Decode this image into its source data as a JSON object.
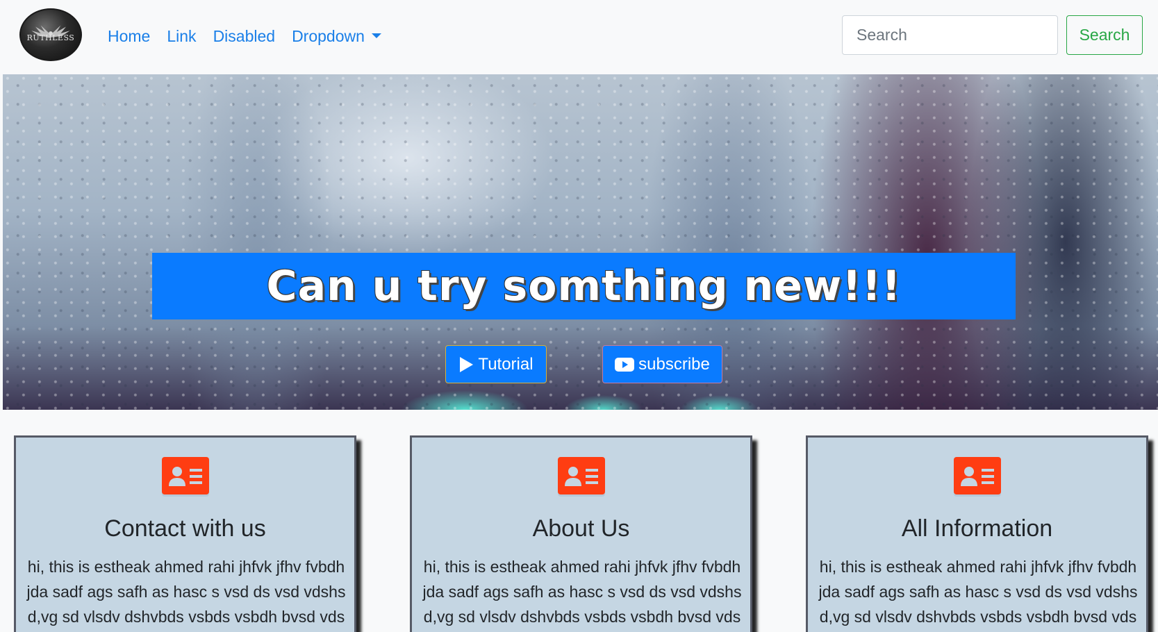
{
  "navbar": {
    "logo_text": "RUTHLESS",
    "links": [
      "Home",
      "Link",
      "Disabled",
      "Dropdown"
    ],
    "search_placeholder": "Search",
    "search_button": "Search",
    "link_color": "#1a7fe8",
    "success_color": "#28a745"
  },
  "hero": {
    "title": "Can u try somthing new!!!",
    "banner_color": "#0a7bff",
    "tutorial_label": "Tutorial",
    "subscribe_label": "subscribe"
  },
  "cards": [
    {
      "title": "Contact with us",
      "icon": "contact-card-icon",
      "text": "hi, this is estheak ahmed rahi jhfvk jfhv fvbdh jda sadf ags safh as hasc s vsd ds vsd vdshs d,vg sd vlsdv dshvbds vsbds vsbdh bvsd vds"
    },
    {
      "title": "About Us",
      "icon": "contact-card-icon",
      "text": "hi, this is estheak ahmed rahi jhfvk jfhv fvbdh jda sadf ags safh as hasc s vsd ds vsd vdshs d,vg sd vlsdv dshvbds vsbds vsbdh bvsd vds"
    },
    {
      "title": "All Information",
      "icon": "contact-card-icon",
      "text": "hi, this is estheak ahmed rahi jhfvk jfhv fvbdh jda sadf ags safh as hasc s vsd ds vsd vdshs d,vg sd vlsdv dshvbds vsbds vsbdh bvsd vds"
    }
  ],
  "icon_color": "#ff3d12"
}
